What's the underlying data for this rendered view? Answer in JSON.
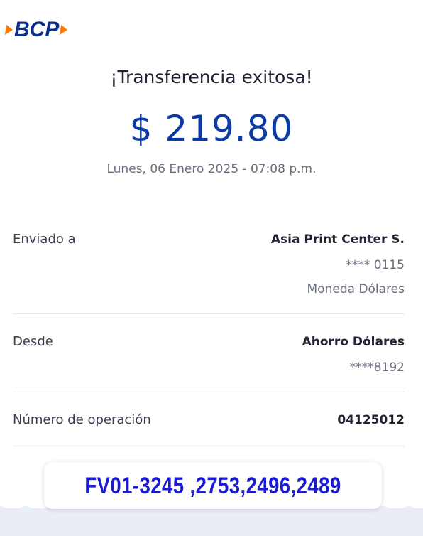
{
  "brand": {
    "name": "BCP",
    "colors": {
      "primary": "#0b2f86",
      "accent": "#ff7a00"
    }
  },
  "receipt": {
    "title": "¡Transferencia exitosa!",
    "amount": "$ 219.80",
    "datetime": "Lunes, 06 Enero 2025 - 07:08 p.m.",
    "amount_color": "#0b3aa6"
  },
  "details": {
    "sent_to": {
      "label": "Enviado a",
      "name": "Asia Print Center S.",
      "account": "**** 0115",
      "currency": "Moneda Dólares"
    },
    "from": {
      "label": "Desde",
      "account_type": "Ahorro Dólares",
      "account": "****8192"
    },
    "operation": {
      "label": "Número de operación",
      "number": "04125012"
    }
  },
  "annotation": {
    "text": "FV01-3245 ,2753,2496,2489",
    "color": "#1b1bd6"
  }
}
